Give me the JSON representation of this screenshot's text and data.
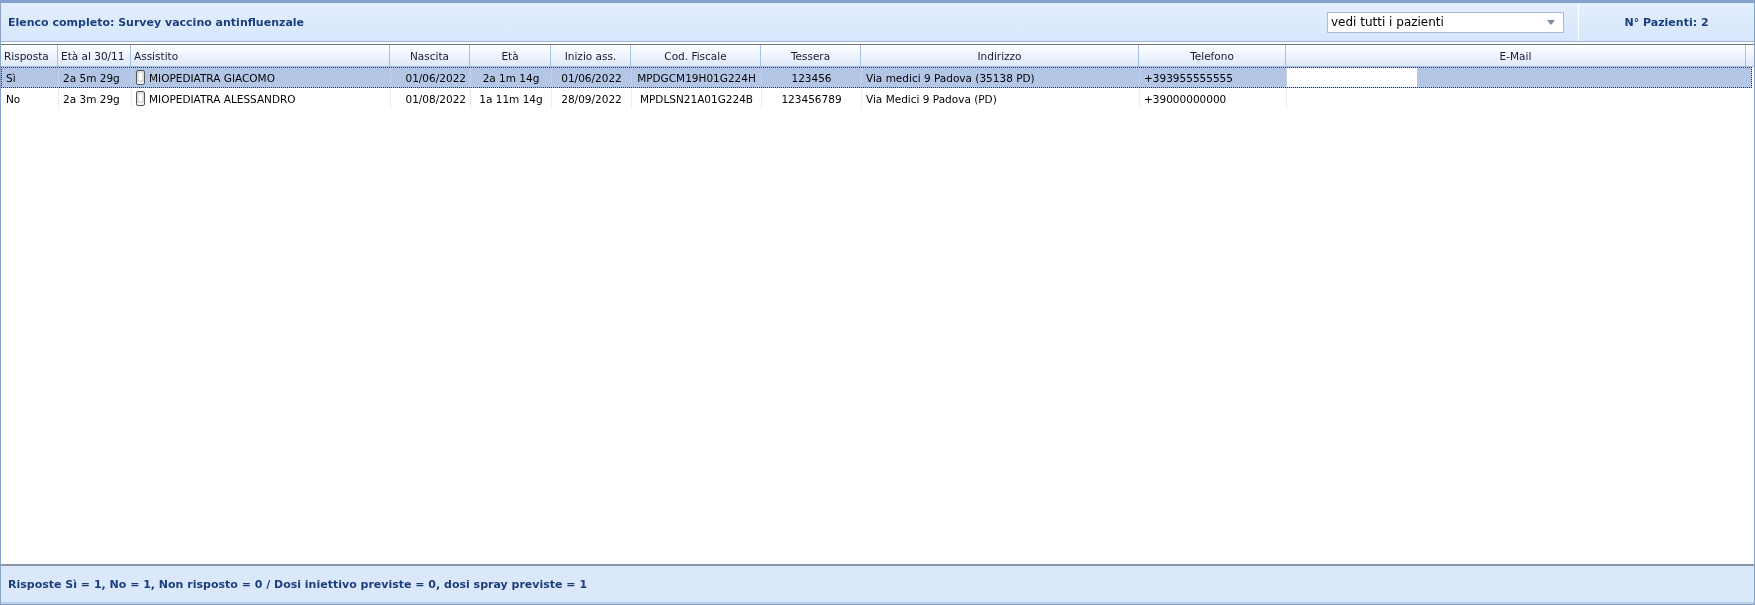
{
  "header": {
    "title": "Elenco completo: Survey vaccino antinfluenzale",
    "filter": {
      "value": "vedi tutti i pazienti"
    },
    "count": "N° Pazienti: 2"
  },
  "table": {
    "columns": [
      "Risposta",
      "Età al 30/11",
      "Assistito",
      "Nascita",
      "Età",
      "Inizio ass.",
      "Cod. Fiscale",
      "Tessera",
      "Indirizzo",
      "Telefono",
      "E-Mail"
    ],
    "rows": [
      {
        "selected": true,
        "cells": [
          "Sì",
          "2a 5m 29g",
          "MIOPEDIATRA GIACOMO",
          "01/06/2022",
          "2a 1m 14g",
          "01/06/2022",
          "MPDGCM19H01G224H",
          "123456",
          "Via medici 9 Padova (35138 PD)",
          "+393955555555",
          ""
        ]
      },
      {
        "selected": false,
        "cells": [
          "No",
          "2a 3m 29g",
          "MIOPEDIATRA ALESSANDRO",
          "01/08/2022",
          "1a 11m 14g",
          "28/09/2022",
          "MPDLSN21A01G224B",
          "123456789",
          "Via Medici 9 Padova (PD)",
          "+39000000000",
          ""
        ]
      }
    ]
  },
  "footer": "Risposte Sì = 1, No = 1, Non risposto = 0 / Dosi iniettivo previste = 0, dosi spray previste = 1"
}
